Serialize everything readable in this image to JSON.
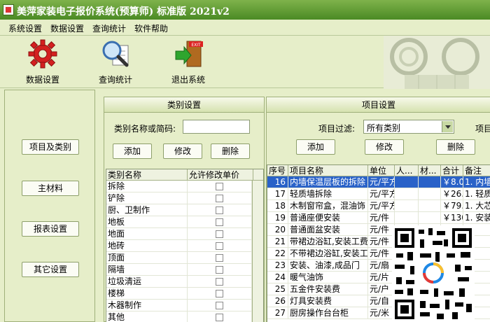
{
  "window": {
    "title": "美萍家装电子报价系统(预算师) 标准版   2021v2"
  },
  "menu": [
    "系统设置",
    "数据设置",
    "查询统计",
    "软件帮助"
  ],
  "toolbar": {
    "data_settings": "数据设置",
    "query_stats": "查询统计",
    "exit_system": "退出系统",
    "exit_sign": "EXIT"
  },
  "sidebar": [
    "项目及类别",
    "主材料",
    "报表设置",
    "其它设置"
  ],
  "category_panel": {
    "header": "类别设置",
    "search_label": "类别名称或简码:",
    "search_value": "",
    "buttons": {
      "add": "添加",
      "edit": "修改",
      "delete": "删除"
    },
    "columns": [
      "类别名称",
      "允许修改单价"
    ],
    "rows": [
      "拆除",
      "铲除",
      "厨、卫制作",
      "地板",
      "地面",
      "地砖",
      "顶面",
      "隔墙",
      "垃圾清运",
      "楼梯",
      "木器制作",
      "其他"
    ]
  },
  "item_panel": {
    "header": "项目设置",
    "filter_label": "项目过滤:",
    "filter_value": "所有类别",
    "filter_label_2": "项目",
    "buttons": {
      "add": "添加",
      "edit": "修改",
      "delete": "删除"
    },
    "columns": [
      "序号",
      "项目名称",
      "单位",
      "人...",
      "材...",
      "合计",
      "备注"
    ],
    "rows": [
      {
        "no": "16",
        "name": "内墙保温层板的拆除",
        "unit": "元/平方",
        "labor": "",
        "material": "",
        "total": "￥8.0",
        "note": "1. 内墙"
      },
      {
        "no": "17",
        "name": "轻质墙拆除",
        "unit": "元/平方",
        "labor": "",
        "material": "",
        "total": "￥26.",
        "note": "1. 轻质"
      },
      {
        "no": "18",
        "name": "木制窗帘盒，混油饰",
        "unit": "元/平方",
        "labor": "",
        "material": "",
        "total": "￥79.",
        "note": "1. 大芯"
      },
      {
        "no": "19",
        "name": "普通座便安装",
        "unit": "元/件",
        "labor": "",
        "material": "",
        "total": "￥130",
        "note": "1. 安装"
      },
      {
        "no": "20",
        "name": "普通面盆安装",
        "unit": "元/件",
        "labor": "",
        "material": "",
        "total": "",
        "note": ""
      },
      {
        "no": "21",
        "name": "带裙边浴缸,安装工费",
        "unit": "元/件",
        "labor": "",
        "material": "",
        "total": "",
        "note": ""
      },
      {
        "no": "22",
        "name": "不带裙边浴缸,安装工",
        "unit": "元/件",
        "labor": "",
        "material": "",
        "total": "",
        "note": ""
      },
      {
        "no": "23",
        "name": "安装、油漆,成品门",
        "unit": "元/扇",
        "labor": "",
        "material": "",
        "total": "",
        "note": ""
      },
      {
        "no": "24",
        "name": "暖气油饰",
        "unit": "元/片",
        "labor": "",
        "material": "",
        "total": "",
        "note": ""
      },
      {
        "no": "25",
        "name": "五金件安装费",
        "unit": "元/户",
        "labor": "",
        "material": "",
        "total": "",
        "note": ""
      },
      {
        "no": "26",
        "name": "灯具安装费",
        "unit": "元/自",
        "labor": "",
        "material": "",
        "total": "",
        "note": ""
      },
      {
        "no": "27",
        "name": "厨房操作台台柜",
        "unit": "元/米",
        "labor": "",
        "material": "",
        "total": "",
        "note": ""
      }
    ]
  },
  "colors": {
    "title_bar": "#4a8a24",
    "selection": "#2a62c8",
    "window_bg": "#e6eec9"
  }
}
